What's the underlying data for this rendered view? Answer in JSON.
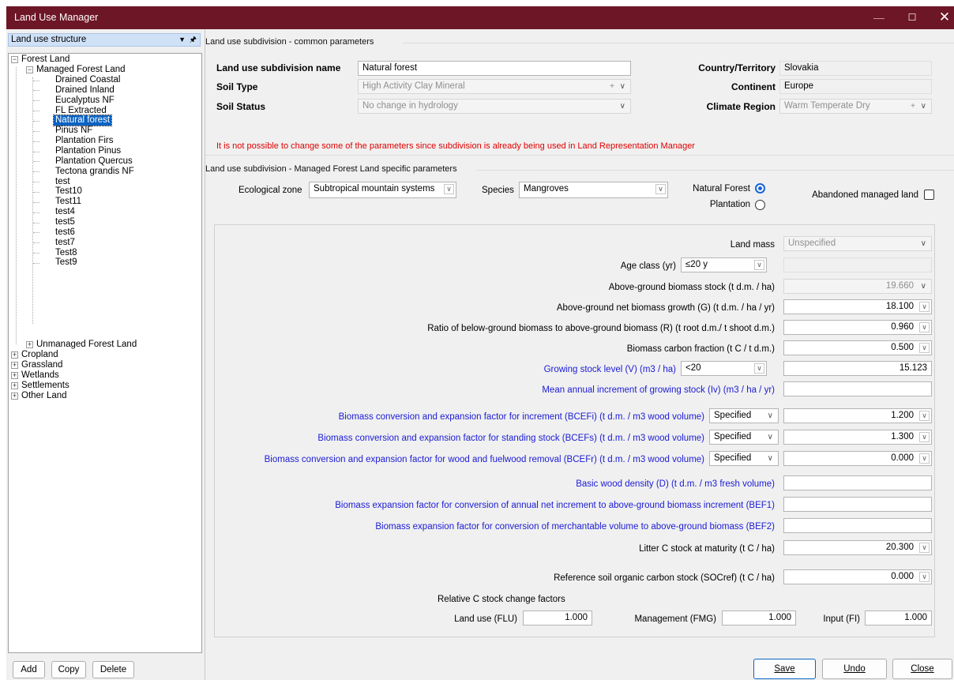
{
  "window": {
    "title": "Land Use Manager",
    "min": "—",
    "max": "☐",
    "close": "✕"
  },
  "pane": {
    "title": "Land use structure",
    "dropdown_glyph": "▼",
    "pin_glyph": "📌",
    "tree": {
      "forest_land": "Forest Land",
      "managed_forest_land": "Managed Forest Land",
      "subdivisions": [
        "Drained Coastal",
        "Drained Inland",
        "Eucalyptus NF",
        "FL Extracted",
        "Natural forest",
        "Pinus NF",
        "Plantation Firs",
        "Plantation Pinus",
        "Plantation Quercus",
        "Tectona grandis NF",
        "test",
        "Test10",
        "Test11",
        "test4",
        "test5",
        "test6",
        "test7",
        "Test8",
        "Test9"
      ],
      "selected": "Natural forest",
      "unmanaged_forest_land": "Unmanaged Forest Land",
      "others": [
        "Cropland",
        "Grassland",
        "Wetlands",
        "Settlements",
        "Other Land"
      ]
    },
    "buttons": {
      "add": "Add",
      "copy": "Copy",
      "delete": "Delete"
    }
  },
  "common": {
    "header": "Land use subdivision - common parameters",
    "name_label": "Land use subdivision name",
    "name_value": "Natural forest",
    "soil_type_label": "Soil Type",
    "soil_type_value": "High Activity Clay Mineral",
    "soil_status_label": "Soil Status",
    "soil_status_value": "No change in hydrology",
    "country_label": "Country/Territory",
    "country_value": "Slovakia",
    "continent_label": "Continent",
    "continent_value": "Europe",
    "climate_label": "Climate Region",
    "climate_value": "Warm Temperate Dry",
    "warning": "It is not possible to change some of the parameters since subdivision is already being used in Land Representation Manager"
  },
  "specific": {
    "header": "Land use subdivision - Managed Forest Land specific parameters",
    "eco_label": "Ecological zone",
    "eco_value": "Subtropical mountain systems",
    "species_label": "Species",
    "species_value": "Mangroves",
    "natural_forest_label": "Natural Forest",
    "plantation_label": "Plantation",
    "abandoned_label": "Abandoned managed land"
  },
  "params": {
    "land_mass_label": "Land mass",
    "land_mass_value": "Unspecified",
    "age_class_label": "Age class (yr)",
    "age_class_value": "≤20 y",
    "agb_stock_label": "Above-ground biomass stock (t d.m. / ha)",
    "agb_stock_value": "19.660",
    "agb_growth_label": "Above-ground net biomass growth (G) (t d.m. / ha / yr)",
    "agb_growth_value": "18.100",
    "ratio_label": "Ratio of below-ground biomass to above-ground biomass (R) (t root d.m./ t shoot d.m.)",
    "ratio_value": "0.960",
    "carbon_fraction_label": "Biomass carbon fraction (t C / t d.m.)",
    "carbon_fraction_value": "0.500",
    "gsl_label": "Growing stock level (V) (m3 / ha)",
    "gsl_select": "<20",
    "gsl_value": "15.123",
    "mai_label": "Mean annual increment of growing stock (Iv) (m3 / ha / yr)",
    "mai_value": "",
    "bcefi_label": "Biomass conversion and expansion factor for increment (BCEFi) (t d.m. / m3 wood volume)",
    "bcefi_select": "Specified",
    "bcefi_value": "1.200",
    "bcefs_label": "Biomass conversion and expansion factor for standing stock (BCEFs) (t d.m. / m3 wood volume)",
    "bcefs_select": "Specified",
    "bcefs_value": "1.300",
    "bcefr_label": "Biomass conversion and expansion factor for wood and fuelwood removal (BCEFr) (t d.m. / m3 wood volume)",
    "bcefr_select": "Specified",
    "bcefr_value": "0.000",
    "density_label": "Basic wood density (D) (t d.m. / m3 fresh volume)",
    "density_value": "",
    "bef1_label": "Biomass expansion factor for conversion of annual net increment to above-ground biomass increment (BEF1)",
    "bef1_value": "",
    "bef2_label": "Biomass expansion factor for conversion of merchantable volume to above-ground biomass (BEF2)",
    "bef2_value": "",
    "litter_label": "Litter C stock at maturity (t C / ha)",
    "litter_value": "20.300",
    "soc_label": "Reference soil organic carbon stock (SOCref) (t C / ha)",
    "soc_value": "0.000",
    "rel_label": "Relative C stock change factors",
    "flu_label": "Land use (FLU)",
    "flu_value": "1.000",
    "fmg_label": "Management (FMG)",
    "fmg_value": "1.000",
    "fi_label": "Input (FI)",
    "fi_value": "1.000"
  },
  "footer": {
    "save": "Save",
    "undo": "Undo",
    "close": "Close"
  },
  "icons": {
    "dropdown": "chevron-down-icon",
    "expand": "plus-icon",
    "collapse": "minus-icon"
  },
  "colors": {
    "titlebar": "#6d1626",
    "selection": "#0a63c4",
    "link_blue": "#1b1bd6",
    "warning": "#e00000"
  }
}
